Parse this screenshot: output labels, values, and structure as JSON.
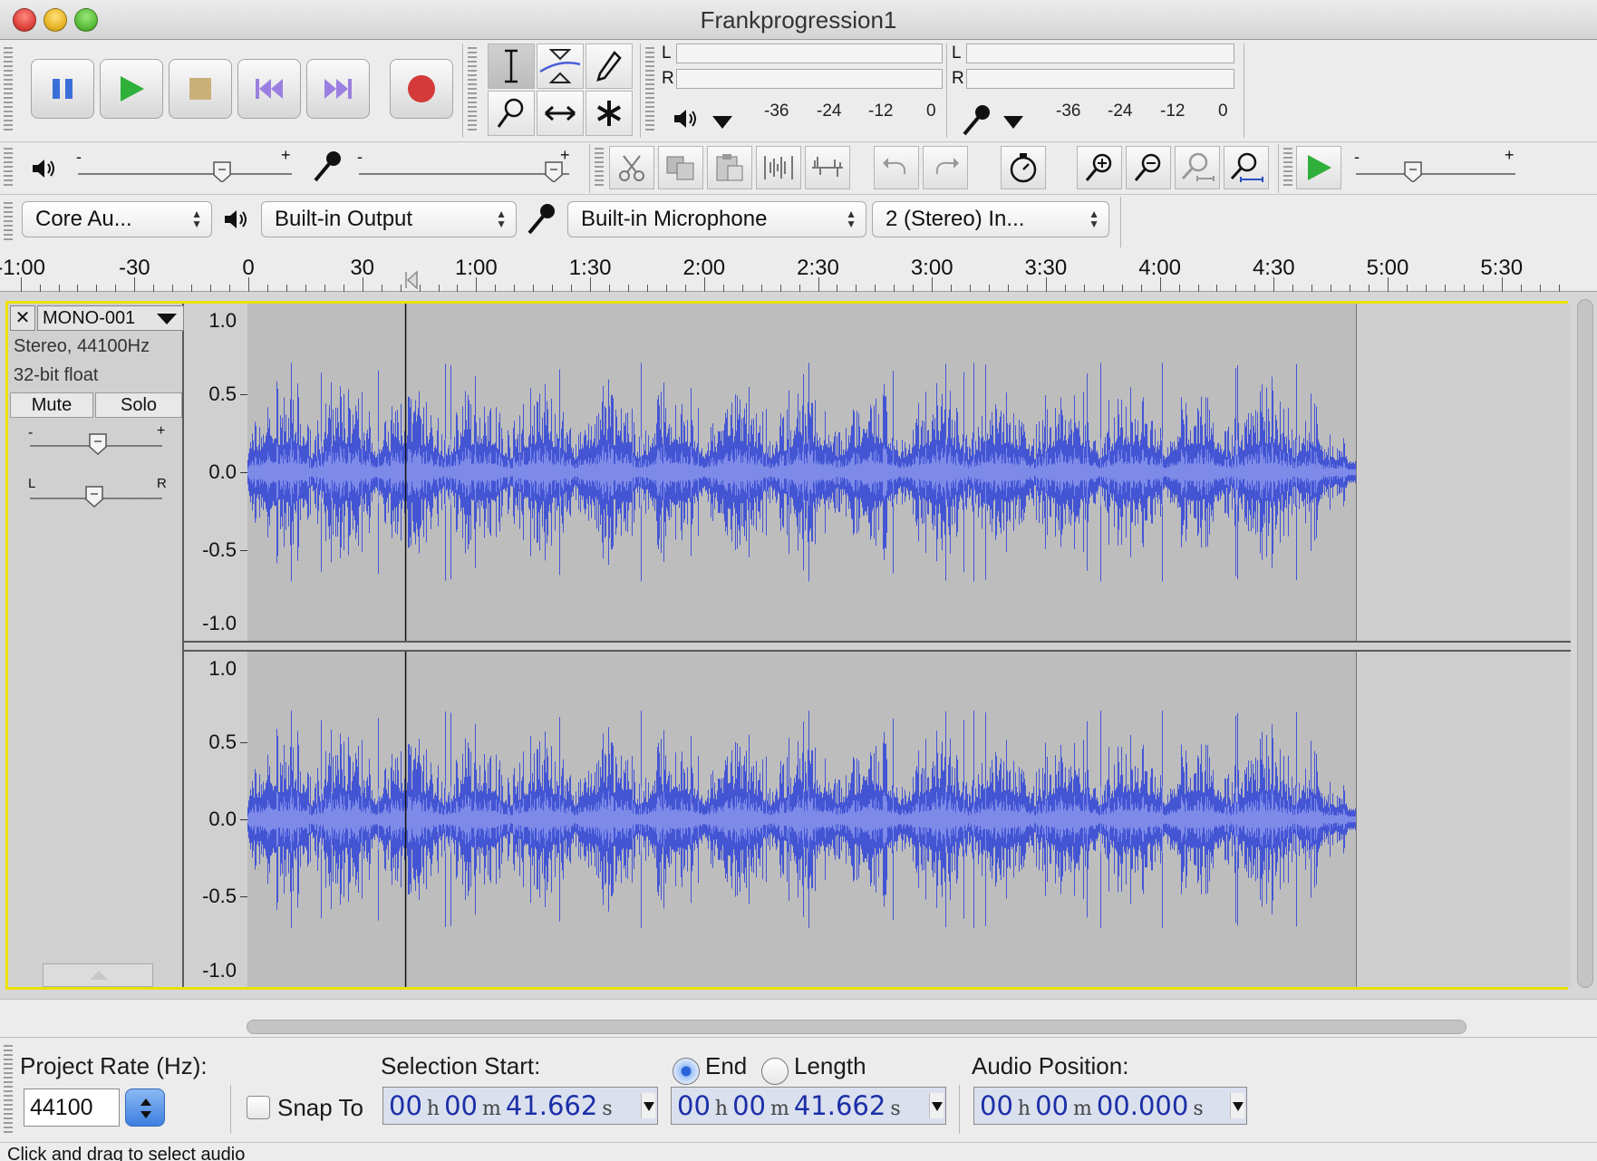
{
  "window": {
    "title": "Frankprogression1"
  },
  "meters": {
    "playback_left_label": "L",
    "playback_right_label": "R",
    "record_left_label": "L",
    "record_right_label": "R",
    "playback_ticks": [
      "-36",
      "-24",
      "-12",
      "0"
    ],
    "record_ticks": [
      "-36",
      "-24",
      "-12",
      "0"
    ]
  },
  "device": {
    "host": "Core Au...",
    "output": "Built-in Output",
    "input": "Built-in Microphone",
    "channels": "2 (Stereo) In..."
  },
  "ruler": {
    "labels": [
      "-1:00",
      "-30",
      "0",
      "30",
      "1:00",
      "1:30",
      "2:00",
      "2:30",
      "3:00",
      "3:30",
      "4:00",
      "4:30",
      "5:00",
      "5:30"
    ]
  },
  "track": {
    "name": "MONO-001",
    "info_format": "Stereo, 44100Hz",
    "info_bits": "32-bit float",
    "close_label": "✕",
    "mute_label": "Mute",
    "solo_label": "Solo",
    "gain_minus": "-",
    "gain_plus": "+",
    "pan_left": "L",
    "pan_right": "R",
    "amplitude_labels": [
      "1.0",
      "0.5",
      "0.0",
      "-0.5",
      "-1.0"
    ],
    "cursor_seconds": 41.662,
    "audio_end_seconds": 292,
    "waveform_color": "#4455d4",
    "rms_color": "#7e8ae8"
  },
  "selection_bar": {
    "project_rate_label": "Project Rate (Hz):",
    "project_rate_value": "44100",
    "snap_to_label": "Snap To",
    "snap_to_checked": false,
    "selection_start_label": "Selection Start:",
    "end_label": "End",
    "length_label": "Length",
    "end_selected": true,
    "audio_position_label": "Audio Position:",
    "start_time": {
      "h": "00",
      "m": "00",
      "s": "41.662"
    },
    "end_time": {
      "h": "00",
      "m": "00",
      "s": "41.662"
    },
    "position_time": {
      "h": "00",
      "m": "00",
      "s": "00.000"
    },
    "unit_h": "h",
    "unit_m": "m",
    "unit_s": "s"
  },
  "status": {
    "text": "Click and drag to select audio"
  }
}
